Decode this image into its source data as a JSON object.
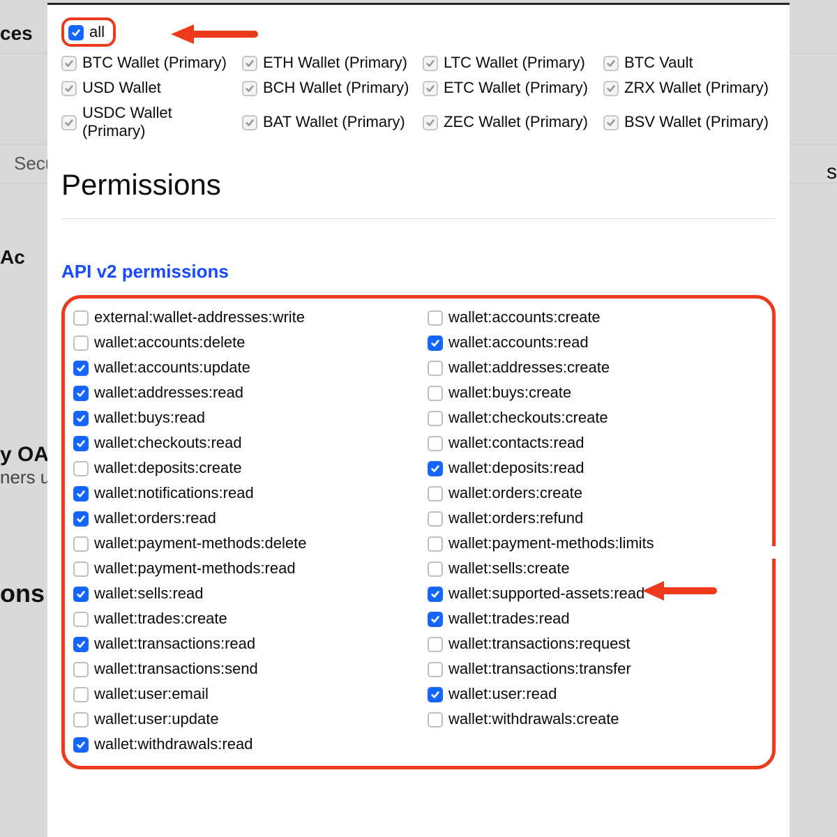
{
  "behind": {
    "ces": "ces",
    "security": "Securi",
    "right": "s",
    "ac": "Ac",
    "oa": "y OA",
    "ners": "ners u",
    "ons": "ons"
  },
  "accounts": {
    "all_label": "all",
    "items": [
      {
        "label": "BTC Wallet (Primary)"
      },
      {
        "label": "ETH Wallet (Primary)"
      },
      {
        "label": "LTC Wallet (Primary)"
      },
      {
        "label": "BTC Vault"
      },
      {
        "label": "USD Wallet"
      },
      {
        "label": "BCH Wallet (Primary)"
      },
      {
        "label": "ETC Wallet (Primary)"
      },
      {
        "label": "ZRX Wallet (Primary)"
      },
      {
        "label": "USDC Wallet (Primary)"
      },
      {
        "label": "BAT Wallet (Primary)"
      },
      {
        "label": "ZEC Wallet (Primary)"
      },
      {
        "label": "BSV Wallet (Primary)"
      }
    ]
  },
  "headings": {
    "permissions": "Permissions",
    "api": "API v2 permissions"
  },
  "permissions": [
    {
      "label": "external:wallet-addresses:write",
      "checked": false
    },
    {
      "label": "wallet:accounts:create",
      "checked": false
    },
    {
      "label": "wallet:accounts:delete",
      "checked": false
    },
    {
      "label": "wallet:accounts:read",
      "checked": true
    },
    {
      "label": "wallet:accounts:update",
      "checked": true
    },
    {
      "label": "wallet:addresses:create",
      "checked": false
    },
    {
      "label": "wallet:addresses:read",
      "checked": true
    },
    {
      "label": "wallet:buys:create",
      "checked": false
    },
    {
      "label": "wallet:buys:read",
      "checked": true
    },
    {
      "label": "wallet:checkouts:create",
      "checked": false
    },
    {
      "label": "wallet:checkouts:read",
      "checked": true
    },
    {
      "label": "wallet:contacts:read",
      "checked": false
    },
    {
      "label": "wallet:deposits:create",
      "checked": false
    },
    {
      "label": "wallet:deposits:read",
      "checked": true
    },
    {
      "label": "wallet:notifications:read",
      "checked": true
    },
    {
      "label": "wallet:orders:create",
      "checked": false
    },
    {
      "label": "wallet:orders:read",
      "checked": true
    },
    {
      "label": "wallet:orders:refund",
      "checked": false
    },
    {
      "label": "wallet:payment-methods:delete",
      "checked": false
    },
    {
      "label": "wallet:payment-methods:limits",
      "checked": false
    },
    {
      "label": "wallet:payment-methods:read",
      "checked": false
    },
    {
      "label": "wallet:sells:create",
      "checked": false
    },
    {
      "label": "wallet:sells:read",
      "checked": true
    },
    {
      "label": "wallet:supported-assets:read",
      "checked": true
    },
    {
      "label": "wallet:trades:create",
      "checked": false
    },
    {
      "label": "wallet:trades:read",
      "checked": true
    },
    {
      "label": "wallet:transactions:read",
      "checked": true
    },
    {
      "label": "wallet:transactions:request",
      "checked": false
    },
    {
      "label": "wallet:transactions:send",
      "checked": false
    },
    {
      "label": "wallet:transactions:transfer",
      "checked": false
    },
    {
      "label": "wallet:user:email",
      "checked": false
    },
    {
      "label": "wallet:user:read",
      "checked": true
    },
    {
      "label": "wallet:user:update",
      "checked": false
    },
    {
      "label": "wallet:withdrawals:create",
      "checked": false
    },
    {
      "label": "wallet:withdrawals:read",
      "checked": true
    }
  ]
}
